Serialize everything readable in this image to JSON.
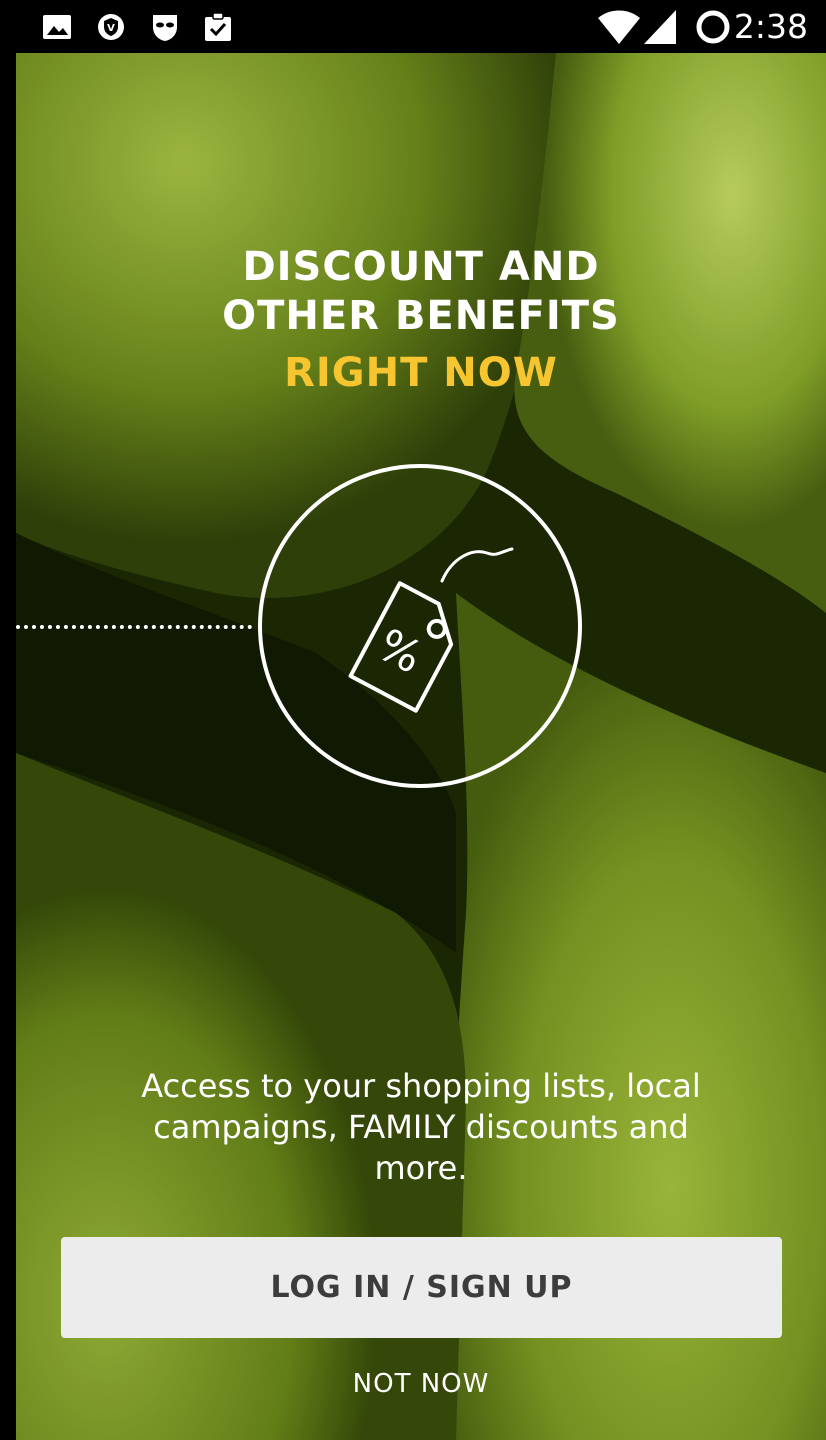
{
  "status_bar": {
    "time": "2:38",
    "left_icons": [
      "gallery-icon",
      "vpn-shield-icon",
      "incognito-mask-icon",
      "clipboard-check-icon"
    ],
    "right_icons": [
      "wifi-icon",
      "cell-signal-icon",
      "sync-ring-icon"
    ]
  },
  "hero": {
    "headline_line1": "DISCOUNT AND",
    "headline_line2": "OTHER BENEFITS",
    "headline_accent": "RIGHT NOW",
    "accent_color": "#f6c530",
    "illustration_icon": "price-tag-percent-icon",
    "description": "Access to your shopping lists, local campaigns, FAMILY discounts and more."
  },
  "actions": {
    "login_label": "LOG IN / SIGN UP",
    "skip_label": "NOT NOW"
  }
}
